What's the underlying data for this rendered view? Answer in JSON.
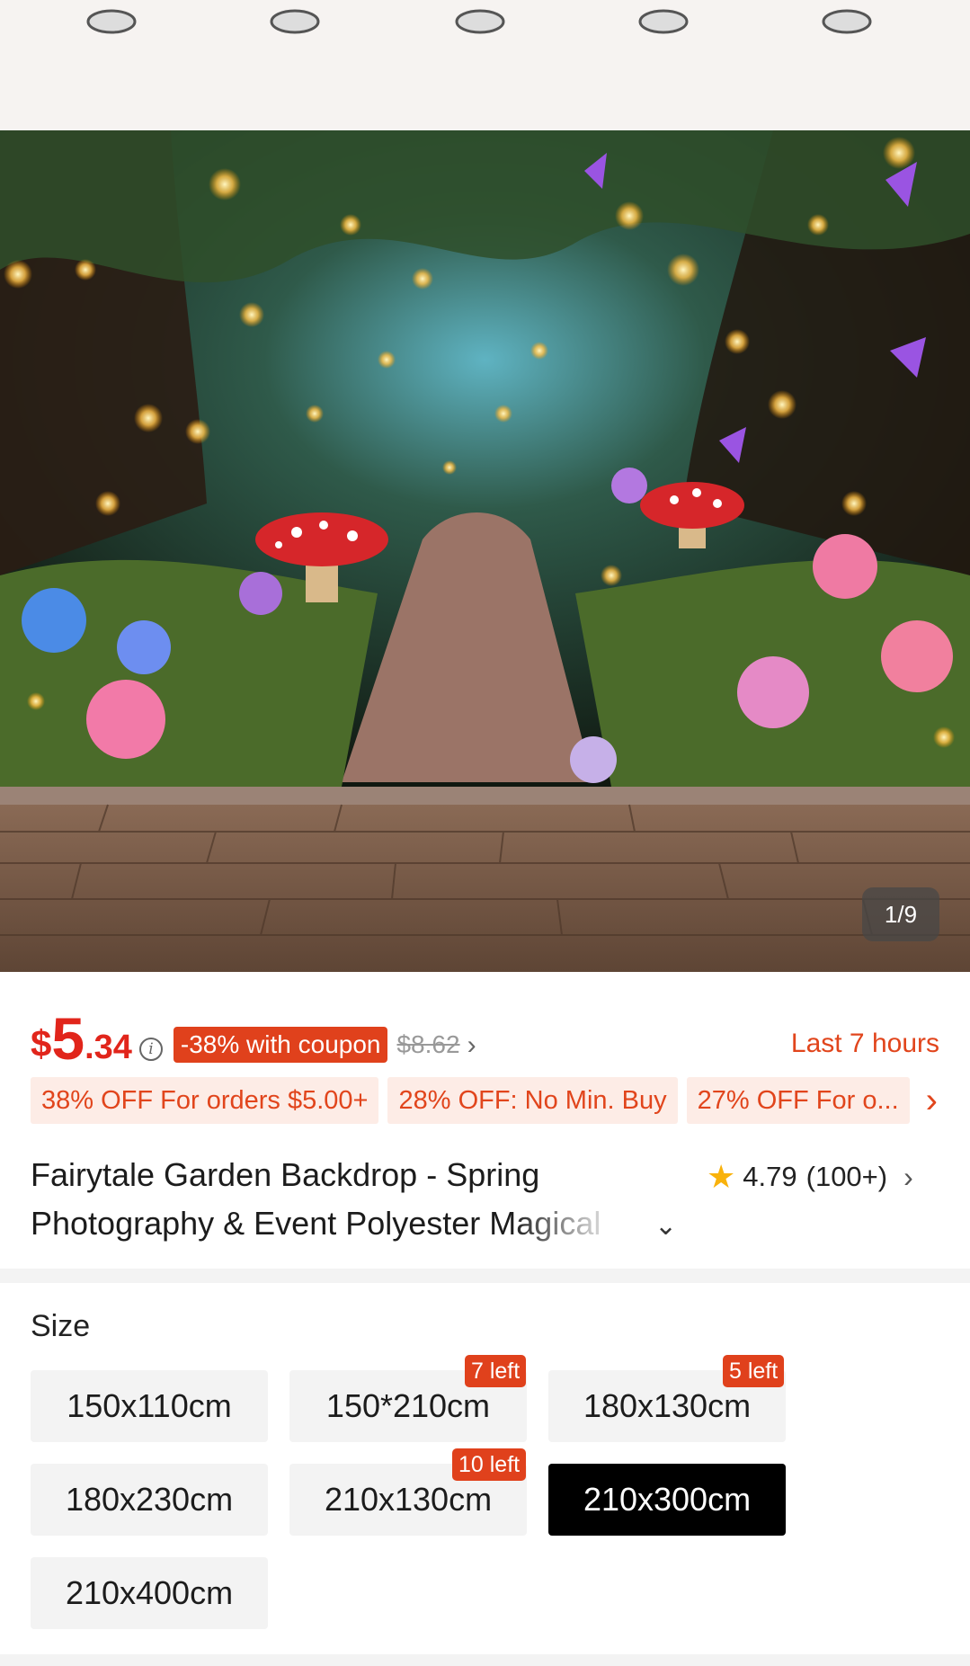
{
  "gallery": {
    "counter": "1/9"
  },
  "price": {
    "currency": "$",
    "integer": "5",
    "decimal": ".34",
    "info_icon": "info-icon",
    "coupon_badge": "-38% with coupon",
    "original": "$8.62",
    "chevron": "›",
    "countdown": "Last 7 hours"
  },
  "offers": {
    "items": [
      "38% OFF For orders $5.00+",
      "28% OFF: No Min. Buy",
      "27% OFF For o..."
    ],
    "arrow": "›"
  },
  "product": {
    "title_line1": "Fairytale Garden Backdrop - Spring",
    "title_line2_a": "Photography & Event Polyester ",
    "title_line2_b": "Magical",
    "expand_chevron": "⌄",
    "rating": "4.79",
    "rating_count": "(100+)",
    "rating_chevron": "›"
  },
  "sizes": {
    "label": "Size",
    "options": [
      {
        "label": "150x110cm",
        "stock": ""
      },
      {
        "label": "150*210cm",
        "stock": "7 left"
      },
      {
        "label": "180x130cm",
        "stock": "5 left"
      },
      {
        "label": "180x230cm",
        "stock": ""
      },
      {
        "label": "210x130cm",
        "stock": "10 left"
      },
      {
        "label": "210x300cm",
        "stock": "",
        "selected": true
      },
      {
        "label": "210x400cm",
        "stock": ""
      }
    ]
  },
  "colors": {
    "accent": "#e1251b",
    "coupon": "#e0411c",
    "offer_bg": "#fdece6",
    "star": "#f9b20b",
    "selected": "#000000"
  }
}
